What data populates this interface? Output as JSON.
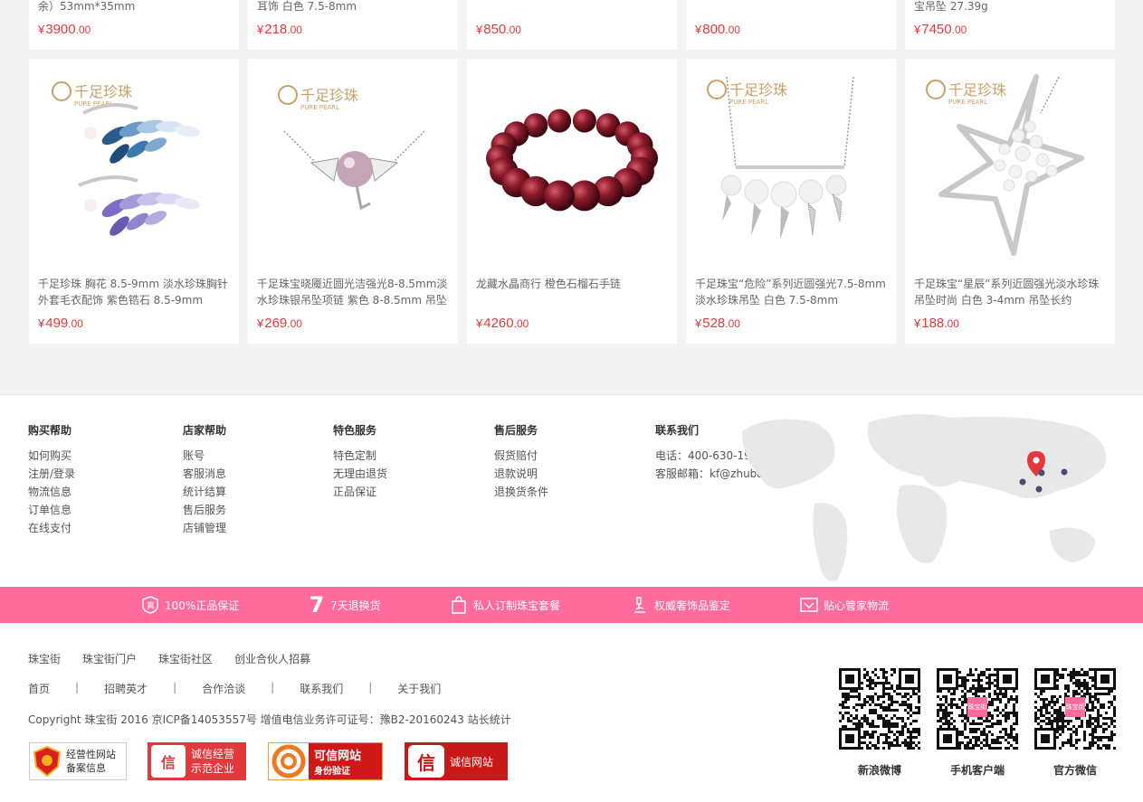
{
  "top_row": [
    {
      "title": "余）53mm*35mm",
      "price_int": "3900",
      "price_dec": ".00"
    },
    {
      "title": "耳饰 白色 7.5-8mm",
      "price_int": "218",
      "price_dec": ".00"
    },
    {
      "title": "",
      "price_int": "850",
      "price_dec": ".00"
    },
    {
      "title": "",
      "price_int": "800",
      "price_dec": ".00"
    },
    {
      "title": "宝吊坠 27.39g",
      "price_int": "7450",
      "price_dec": ".00"
    }
  ],
  "products": [
    {
      "title": "千足珍珠 胸花 8.5-9mm 淡水珍珠胸针外套毛衣配饰 紫色锆石 8.5-9mm",
      "price_int": "499",
      "price_dec": ".00",
      "image": "brooch-leaves",
      "brand_cn": "千足珍珠",
      "brand_en": "PURE PEARL"
    },
    {
      "title": "千足珠宝晓魇近圆光洁强光8-8.5mm淡水珍珠银吊坠项链 紫色 8-8.5mm 吊坠",
      "price_int": "269",
      "price_dec": ".00",
      "image": "demon-pendant",
      "brand_cn": "千足珍珠",
      "brand_en": "PURE PEARL"
    },
    {
      "title": "龙藏水晶商行 橙色石榴石手链",
      "price_int": "4260",
      "price_dec": ".00",
      "image": "garnet-bracelet"
    },
    {
      "title": "千足珠宝“危险”系列近圆强光7.5-8mm淡水珍珠吊坠 白色 7.5-8mm",
      "price_int": "528",
      "price_dec": ".00",
      "image": "fang-necklace",
      "brand_cn": "千足珍珠",
      "brand_en": "PURE PEARL"
    },
    {
      "title": "千足珠宝“星辰”系列近圆强光淡水珍珠吊坠时尚 白色 3-4mm 吊坠长约",
      "price_int": "188",
      "price_dec": ".00",
      "image": "star-pendant",
      "brand_cn": "千足珍珠",
      "brand_en": "PURE PEARL"
    }
  ],
  "currency": "¥",
  "footer": {
    "columns": [
      {
        "title": "购买帮助",
        "links": [
          "如何购买",
          "注册/登录",
          "物流信息",
          "订单信息",
          "在线支付"
        ]
      },
      {
        "title": "店家帮助",
        "links": [
          "账号",
          "客服消息",
          "统计结算",
          "售后服务",
          "店铺管理"
        ]
      },
      {
        "title": "特色服务",
        "links": [
          "特色定制",
          "无理由退货",
          "正品保证"
        ]
      },
      {
        "title": "售后服务",
        "links": [
          "假货赔付",
          "退款说明",
          "退换货条件"
        ]
      }
    ],
    "contact": {
      "title": "联系我们",
      "phone": "电话：400-630-1999",
      "email": "客服邮箱：kf@zhubaojie.com"
    }
  },
  "service_bar": [
    {
      "label": "100%正品保证",
      "icon": "shield-icon"
    },
    {
      "label": "7天退换货",
      "icon": "seven-icon",
      "icon_text": "7"
    },
    {
      "label": "私人订制珠宝套餐",
      "icon": "bag-icon"
    },
    {
      "label": "权威奢饰品鉴定",
      "icon": "microscope-icon"
    },
    {
      "label": "贴心管家物流",
      "icon": "gift-box-icon"
    }
  ],
  "bottom": {
    "row1": [
      "珠宝街",
      "珠宝街门户",
      "珠宝街社区",
      "创业合伙人招募"
    ],
    "row2": [
      "首页",
      "招聘英才",
      "合作洽谈",
      "联系我们",
      "关于我们"
    ],
    "separator": "|",
    "copyright": "Copyright 珠宝街 2016 京ICP备14053557号 增值电信业务许可证号：豫B2-20160243  站长统计",
    "badges": [
      {
        "line1": "经营性网站",
        "line2": "备案信息"
      },
      {
        "line1": "诚信经营",
        "line2": "示范企业"
      },
      {
        "line1": "可信网站",
        "line2": "身份验证"
      },
      {
        "line1": "诚信网站"
      }
    ],
    "qr_codes": [
      {
        "caption": "新浪微博"
      },
      {
        "caption": "手机客户端",
        "center_text": "珠宝街"
      },
      {
        "caption": "官方微信",
        "center_text": "珠宝街"
      }
    ]
  },
  "colors": {
    "price": "#e4393c",
    "pink_bar": "#ff6b9a",
    "bg": "#f3f3f3"
  }
}
